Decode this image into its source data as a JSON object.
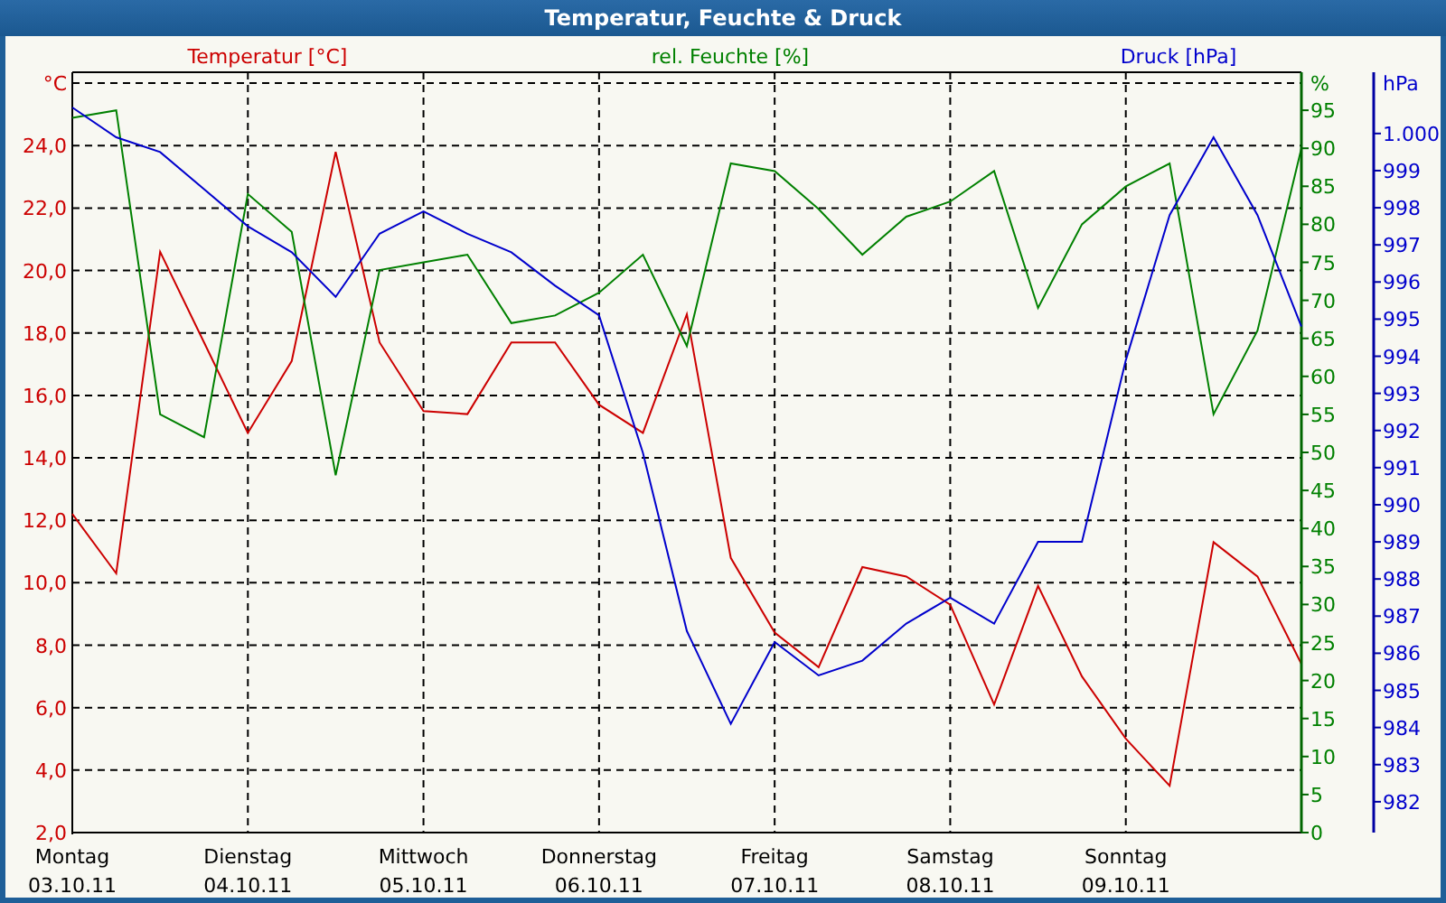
{
  "window": {
    "title": "Temperatur, Feuchte & Druck"
  },
  "chart": {
    "dates": [
      "03.10.11",
      "04.10.11",
      "05.10.11",
      "06.10.11",
      "07.10.11",
      "08.10.11",
      "09.10.11"
    ],
    "axes": [
      {
        "unit": "°C",
        "chart_data": {
          "type": "line",
          "categories": [
            "Montag",
            null,
            null,
            null,
            "Dienstag",
            null,
            null,
            null,
            "Mittwoch",
            null,
            null,
            null,
            "Donnerstag",
            null,
            null,
            null,
            "Freitag",
            null,
            null,
            null,
            "Samstag",
            null,
            null,
            null,
            "Sonntag",
            null,
            null,
            null,
            null
          ],
          "ylim": [
            2,
            26.35
          ],
          "yticks": [
            {
              "value": 2,
              "label": "2,0"
            },
            {
              "value": 4,
              "label": "4,0"
            },
            {
              "value": 6,
              "label": "6,0"
            },
            {
              "value": 8,
              "label": "8,0"
            },
            {
              "value": 10,
              "label": "10,0"
            },
            {
              "value": 12,
              "label": "12,0"
            },
            {
              "value": 14,
              "label": "14,0"
            },
            {
              "value": 16,
              "label": "16,0"
            },
            {
              "value": 18,
              "label": "18,0"
            },
            {
              "value": 20,
              "label": "20,0"
            },
            {
              "value": 22,
              "label": "22,0"
            },
            {
              "value": 24,
              "label": "24,0"
            }
          ],
          "series": [
            {
              "name": "Temperatur [°C]",
              "color": "#cc0000",
              "values": [
                12.2,
                10.3,
                20.6,
                17.7,
                14.8,
                17.1,
                23.8,
                17.7,
                15.5,
                15.4,
                17.7,
                17.7,
                15.7,
                14.8,
                18.6,
                10.8,
                8.4,
                7.3,
                10.5,
                10.2,
                9.3,
                6.1,
                9.9,
                7.0,
                5.0,
                3.5,
                11.3,
                10.2,
                7.4
              ]
            }
          ]
        }
      },
      {
        "unit": "%",
        "chart_data": {
          "type": "line",
          "ylim": [
            0,
            100
          ],
          "yticks": [
            0,
            5,
            10,
            15,
            20,
            25,
            30,
            35,
            40,
            45,
            50,
            55,
            60,
            65,
            70,
            75,
            80,
            85,
            90,
            95
          ],
          "series": [
            {
              "name": "rel. Feuchte [%]",
              "color": "#008000",
              "values": [
                94,
                95,
                55,
                52,
                84,
                79,
                47,
                74,
                75,
                76,
                67,
                68,
                71,
                76,
                64,
                88,
                87,
                82,
                76,
                81,
                83,
                87,
                69,
                80,
                85,
                88,
                55,
                66,
                90
              ]
            }
          ]
        }
      },
      {
        "unit": "hPa",
        "chart_data": {
          "type": "line",
          "ylim": [
            981.17,
            1001.65
          ],
          "yticks": [
            982,
            983,
            984,
            985,
            986,
            987,
            988,
            989,
            990,
            991,
            992,
            993,
            994,
            995,
            996,
            997,
            998,
            999,
            {
              "value": 1000,
              "label": "1.000"
            }
          ],
          "series": [
            {
              "name": "Druck [hPa]",
              "color": "#0000cc",
              "values": [
                1000.7,
                999.9,
                999.5,
                998.5,
                997.5,
                996.8,
                995.6,
                997.3,
                997.9,
                997.3,
                996.8,
                995.9,
                995.1,
                991.4,
                986.6,
                984.1,
                986.3,
                985.4,
                985.8,
                986.8,
                987.5,
                986.8,
                989.0,
                989.0,
                993.9,
                997.8,
                999.9,
                997.8,
                994.8
              ]
            }
          ]
        }
      }
    ]
  }
}
